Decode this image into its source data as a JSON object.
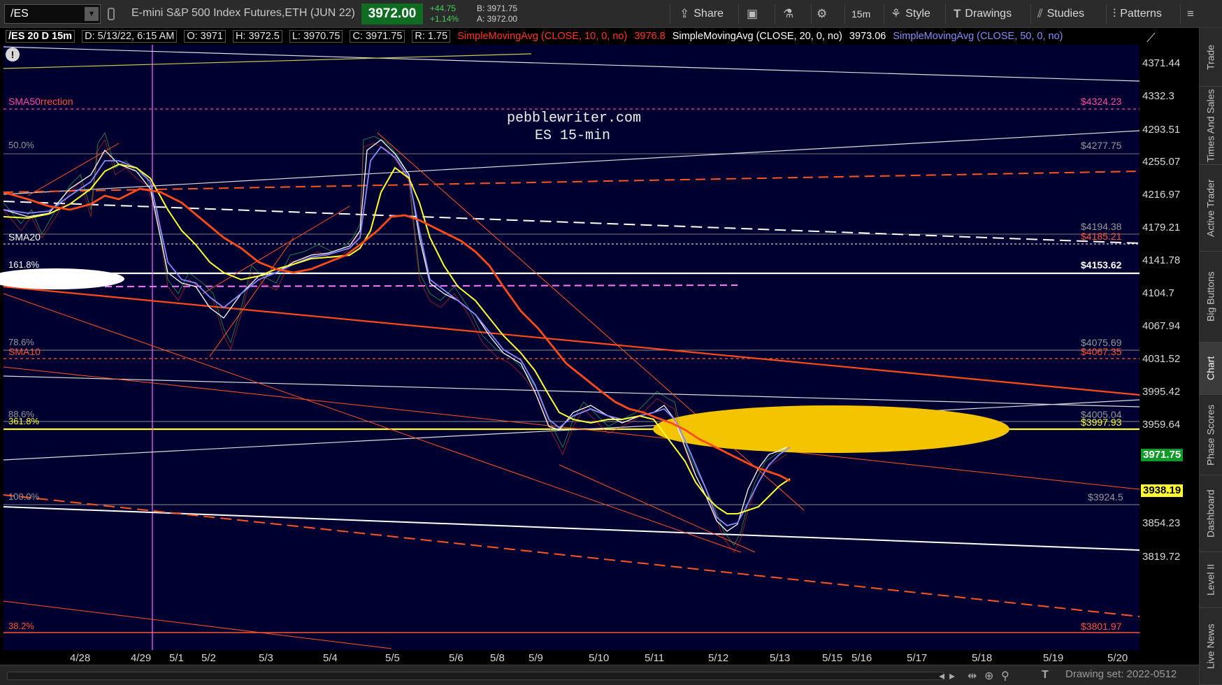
{
  "toolbar": {
    "symbol": "/ES",
    "instrument": "E-mini S&P 500 Index Futures,ETH (JUN 22)",
    "last_price": "3972.00",
    "change": "+44.75",
    "change_pct": "+1.14%",
    "bid": "B: 3971.75",
    "ask": "A: 3972.00",
    "share": "Share",
    "timeframe": "15m",
    "style": "Style",
    "drawings": "Drawings",
    "studies": "Studies",
    "patterns": "Patterns"
  },
  "infobar": {
    "chart_id": "/ES 20 D 15m",
    "date": "D: 5/13/22, 6:15 AM",
    "open": "O: 3971",
    "high": "H: 3972.5",
    "low": "L: 3970.75",
    "close": "C: 3971.75",
    "range": "R: 1.75",
    "sma10_label": "SimpleMovingAvg (CLOSE, 10, 0, no)",
    "sma10_value": "3976.8",
    "sma20_label": "SimpleMovingAvg (CLOSE, 20, 0, no)",
    "sma20_value": "3973.06",
    "sma50_label": "SimpleMovingAvg (CLOSE, 50, 0, no)"
  },
  "overlay": {
    "site": "pebblewriter.com",
    "subtitle": "ES 15-min"
  },
  "chart_labels": {
    "sma50": "SMA50",
    "correction": "rrection",
    "fib_50": "50.0%",
    "sma20": "SMA20",
    "fib_161": "161.8%",
    "fib_786": "78.6%",
    "sma10": "SMA10",
    "fib_886": "88.6%",
    "fib_361": "361.8%",
    "fib_100": "100.0%",
    "fib_382": "38.2%"
  },
  "level_labels": {
    "l4324a": "$4324.23",
    "l4324b": "$4324.23",
    "l4277": "$4277.75",
    "l4194": "$4194.38",
    "l4185": "$4185.21",
    "l4153": "$4153.62",
    "l4075": "$4075.69",
    "l4067": "$4067.35",
    "l4005": "$4005.04",
    "l3997": "$3997.93",
    "l3924": "$3924.5",
    "l3801": "$3801.97"
  },
  "price_axis": [
    "4371.44",
    "4332.3",
    "4293.51",
    "4255.07",
    "4216.97",
    "4179.21",
    "4141.78",
    "4104.7",
    "4067.94",
    "4031.52",
    "3995.42",
    "3959.64",
    "3924.19",
    "3889.05",
    "3854.23",
    "3819.72"
  ],
  "price_tags": {
    "last": "3971.75",
    "sma": "3938.19"
  },
  "dates": [
    "4/28",
    "4/29",
    "5/1",
    "5/2",
    "5/3",
    "5/4",
    "5/5",
    "5/6",
    "5/8",
    "5/9",
    "5/10",
    "5/11",
    "5/12",
    "5/13",
    "5/15",
    "5/16",
    "5/17",
    "5/18",
    "5/19",
    "5/20"
  ],
  "side_tabs": [
    "Trade",
    "Times And Sales",
    "Active Trader",
    "Big Buttons",
    "Chart",
    "Phase Scores",
    "Dashboard",
    "Level II",
    "Live News"
  ],
  "status": {
    "drawing_set": "Drawing set: 2022-0512"
  },
  "colors": {
    "price_up": "#0f6d22",
    "sma10": "#ffff33",
    "sma20": "#ffffff",
    "sma50": "#ff4a1a",
    "sma_blue": "#8a8aff",
    "background": "#000030",
    "target_ellipse": "#f5c400"
  }
}
